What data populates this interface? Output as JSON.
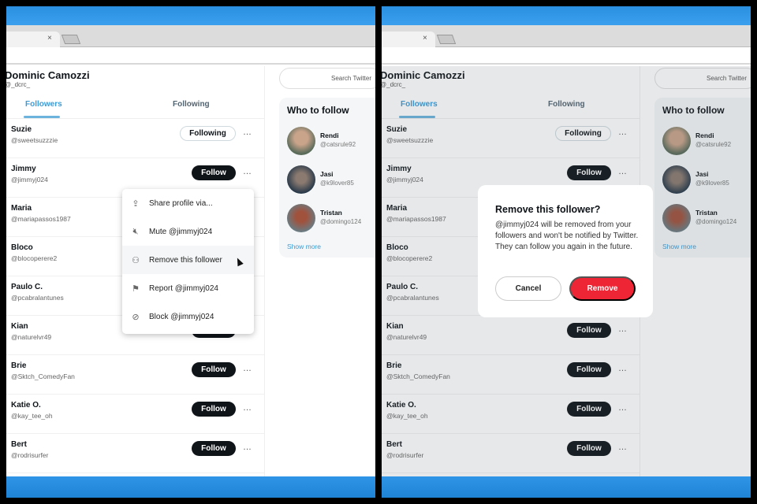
{
  "profile": {
    "name": "Dominic Camozzi",
    "handle": "@_dcrc_"
  },
  "tabs": [
    {
      "label": "Followers",
      "active": true
    },
    {
      "label": "Following",
      "active": false
    }
  ],
  "followers": [
    {
      "name": "Suzie",
      "handle": "@sweetsuzzzie",
      "button": "Following"
    },
    {
      "name": "Jimmy",
      "handle": "@jimmyj024",
      "button": "Follow"
    },
    {
      "name": "Maria",
      "handle": "@mariapassos1987",
      "button": "Follow"
    },
    {
      "name": "Bloco",
      "handle": "@blocoperere2",
      "button": "Follow"
    },
    {
      "name": "Paulo C.",
      "handle": "@pcabralantunes",
      "button": "Follow"
    },
    {
      "name": "Kian",
      "handle": "@naturelvr49",
      "button": "Follow"
    },
    {
      "name": "Brie",
      "handle": "@Sktch_ComedyFan",
      "button": "Follow"
    },
    {
      "name": "Katie O.",
      "handle": "@kay_tee_oh",
      "button": "Follow"
    },
    {
      "name": "Bert",
      "handle": "@rodrisurfer",
      "button": "Follow"
    }
  ],
  "more_icon": "…",
  "search": {
    "placeholder": "Search Twitter"
  },
  "who_to_follow": {
    "title": "Who to follow",
    "show_more": "Show more",
    "items": [
      {
        "name": "Rendi",
        "handle": "@catsrule92"
      },
      {
        "name": "Jasi",
        "handle": "@k9lover85"
      },
      {
        "name": "Tristan",
        "handle": "@domingo124"
      }
    ]
  },
  "menu": {
    "items": [
      {
        "icon": "share-icon",
        "glyph": "⇪",
        "label": "Share profile via..."
      },
      {
        "icon": "mute-icon",
        "glyph": "🔇︎",
        "label": "Mute @jimmyj024"
      },
      {
        "icon": "remove-user-icon",
        "glyph": "⚇",
        "label": "Remove this follower"
      },
      {
        "icon": "flag-icon",
        "glyph": "⚑",
        "label": "Report @jimmyj024"
      },
      {
        "icon": "block-icon",
        "glyph": "⊘",
        "label": "Block @jimmyj024"
      }
    ]
  },
  "dialog": {
    "title": "Remove this follower?",
    "body": "@jimmyj024 will be removed from your followers and won't be notified by Twitter. They can follow you again in the future.",
    "cancel": "Cancel",
    "confirm": "Remove"
  },
  "colors": {
    "accent": "#3d9bd6",
    "danger": "#ee2535",
    "follow_btn": "#0f1419"
  }
}
